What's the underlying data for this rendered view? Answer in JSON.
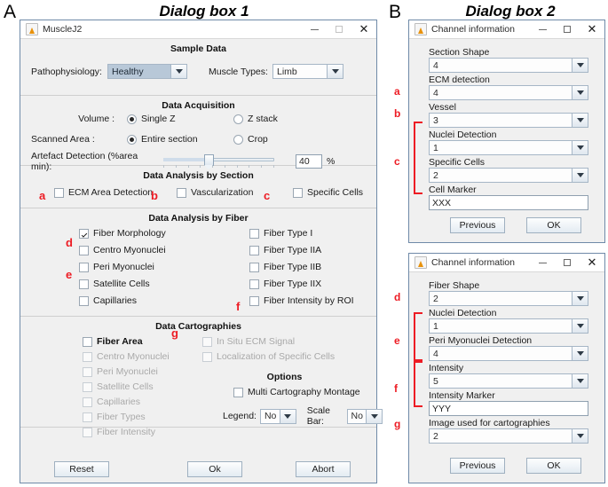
{
  "panels": {
    "a_letter": "A",
    "b_letter": "B",
    "a_title": "Dialog box 1",
    "b_title": "Dialog box 2"
  },
  "colors": {
    "annotation_red": "#ed1c24",
    "dialog_bg": "#f0f0f0",
    "combo_selected": "#b8c8d8",
    "border": "#6f8aa8"
  },
  "dialog1": {
    "titlebar": {
      "title": "MuscleJ2",
      "minimize": "minimize",
      "maximize": "maximize",
      "close": "close"
    },
    "sample_data": {
      "title": "Sample Data",
      "pathophysiology_label": "Pathophysiology:",
      "pathophysiology_value": "Healthy",
      "muscle_types_label": "Muscle Types:",
      "muscle_types_value": "Limb"
    },
    "data_acquisition": {
      "title": "Data Acquisition",
      "volume_label": "Volume :",
      "volume_opt1": "Single Z",
      "volume_opt2": "Z stack",
      "volume_selected": "Single Z",
      "scanned_label": "Scanned Area :",
      "scanned_opt1": "Entire section",
      "scanned_opt2": "Crop",
      "scanned_selected": "Entire section",
      "artefact_label": "Artefact Detection (%area min):",
      "artefact_value": "40",
      "artefact_unit": "%"
    },
    "analysis_section": {
      "title": "Data Analysis by Section",
      "items": [
        {
          "label": "ECM Area Detection",
          "checked": false,
          "ann": "a"
        },
        {
          "label": "Vascularization",
          "checked": false,
          "ann": "b"
        },
        {
          "label": "Specific Cells",
          "checked": false,
          "ann": "c"
        }
      ]
    },
    "analysis_fiber": {
      "title": "Data Analysis by Fiber",
      "left": [
        {
          "label": "Fiber Morphology",
          "checked": true,
          "ann": "d"
        },
        {
          "label": "Centro Myonuclei",
          "checked": false,
          "ann": ""
        },
        {
          "label": "Peri Myonuclei",
          "checked": false,
          "ann": "e"
        },
        {
          "label": "Satellite Cells",
          "checked": false,
          "ann": ""
        },
        {
          "label": "Capillaries",
          "checked": false,
          "ann": ""
        }
      ],
      "right": [
        {
          "label": "Fiber Type I",
          "checked": false,
          "ann": ""
        },
        {
          "label": "Fiber Type IIA",
          "checked": false,
          "ann": ""
        },
        {
          "label": "Fiber Type IIB",
          "checked": false,
          "ann": ""
        },
        {
          "label": "Fiber Type IIX",
          "checked": false,
          "ann": ""
        },
        {
          "label": "Fiber Intensity by ROI",
          "checked": false,
          "ann": "f"
        }
      ]
    },
    "cartographies": {
      "title": "Data Cartographies",
      "ann": "g",
      "left": [
        {
          "label": "Fiber Area",
          "checked": false,
          "disabled": false
        },
        {
          "label": "Centro Myonuclei",
          "checked": false,
          "disabled": true
        },
        {
          "label": "Peri Myonuclei",
          "checked": false,
          "disabled": true
        },
        {
          "label": "Satellite Cells",
          "checked": false,
          "disabled": true
        },
        {
          "label": "Capillaries",
          "checked": false,
          "disabled": true
        },
        {
          "label": "Fiber Types",
          "checked": false,
          "disabled": true
        },
        {
          "label": "Fiber Intensity",
          "checked": false,
          "disabled": true
        }
      ],
      "right": [
        {
          "label": "In Situ ECM Signal",
          "checked": false,
          "disabled": true
        },
        {
          "label": "Localization of Specific Cells",
          "checked": false,
          "disabled": true
        }
      ],
      "options_title": "Options",
      "montage_label": "Multi Cartography Montage",
      "montage_checked": false,
      "legend_label": "Legend:",
      "legend_value": "No",
      "scalebar_label": "Scale Bar:",
      "scalebar_value": "No"
    },
    "buttons": {
      "reset": "Reset",
      "ok": "Ok",
      "abort": "Abort"
    }
  },
  "dialog2a": {
    "titlebar": {
      "title": "Channel information"
    },
    "fields": [
      {
        "label": "Section Shape",
        "value": "4",
        "type": "combo",
        "ann": ""
      },
      {
        "label": "ECM detection",
        "value": "4",
        "type": "combo",
        "ann": "a"
      },
      {
        "label": "Vessel",
        "value": "3",
        "type": "combo",
        "ann": "b"
      },
      {
        "label": "Nuclei Detection",
        "value": "1",
        "type": "combo",
        "ann": ""
      },
      {
        "label": "Specific Cells",
        "value": "2",
        "type": "combo",
        "ann": "c"
      },
      {
        "label": "Cell Marker",
        "value": "XXX",
        "type": "text",
        "ann": ""
      }
    ],
    "buttons": {
      "previous": "Previous",
      "ok": "OK"
    }
  },
  "dialog2b": {
    "titlebar": {
      "title": "Channel information"
    },
    "fields": [
      {
        "label": "Fiber Shape",
        "value": "2",
        "type": "combo",
        "ann": "d"
      },
      {
        "label": "Nuclei Detection",
        "value": "1",
        "type": "combo",
        "ann": ""
      },
      {
        "label": "Peri Myonuclei Detection",
        "value": "4",
        "type": "combo",
        "ann": "e"
      },
      {
        "label": "Intensity",
        "value": "5",
        "type": "combo",
        "ann": ""
      },
      {
        "label": "Intensity Marker",
        "value": "YYY",
        "type": "text",
        "ann": "f"
      },
      {
        "label": "Image used for cartographies",
        "value": "2",
        "type": "combo",
        "ann": "g"
      }
    ],
    "buttons": {
      "previous": "Previous",
      "ok": "OK"
    }
  }
}
